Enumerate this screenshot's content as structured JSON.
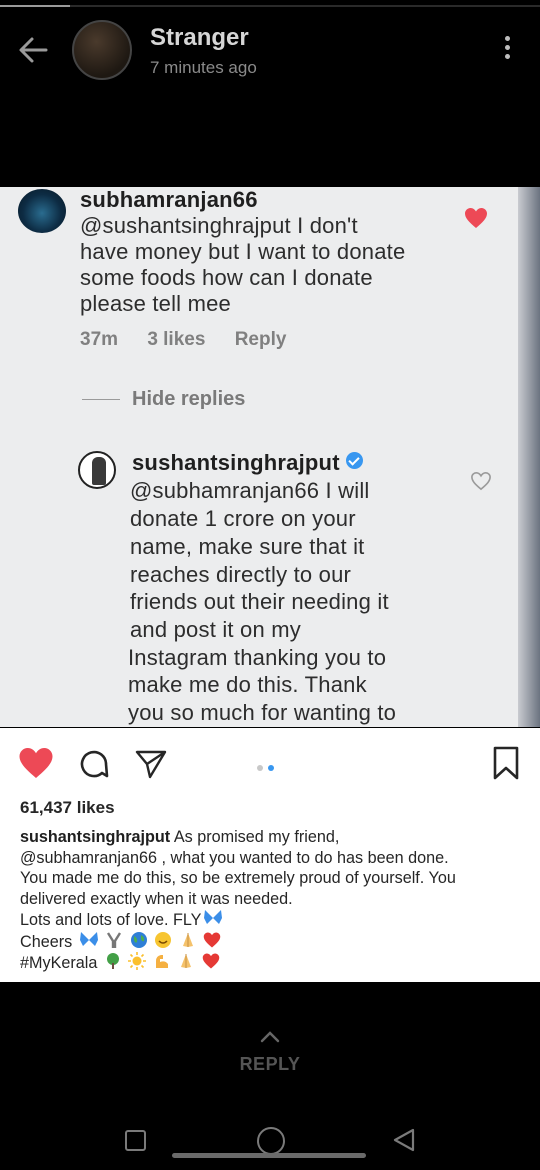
{
  "header": {
    "contact_name": "Stranger",
    "last_seen": "7 minutes ago"
  },
  "shared_screenshot": {
    "comment": {
      "username": "subhamranjan66",
      "lines": [
        "@sushantsinghrajput I don't",
        "have money but I want to donate",
        "some foods how can I donate",
        "please tell mee"
      ],
      "time": "37m",
      "likes": "3 likes",
      "reply": "Reply",
      "liked": true
    },
    "hide_replies": "Hide replies",
    "reply_comment": {
      "username": "sushantsinghrajput",
      "verified": true,
      "lines": [
        "@subhamranjan66 I will",
        "donate 1 crore on your",
        "name, make sure that it",
        "reaches directly to our",
        "friends out their needing it",
        "and post it on my",
        "Instagram thanking you to",
        "make me do this. Thank",
        "you so much for wanting to"
      ]
    }
  },
  "post": {
    "likes": "61,437 likes",
    "caption_user": "sushantsinghrajput",
    "caption_line1": "As promised my friend,",
    "caption_line2": "@subhamranjan66 , what you wanted to do has been done.",
    "caption_line3": "You made me do this, so be extremely proud of yourself. You",
    "caption_line4": "delivered exactly when it was needed.",
    "caption_line5": "Lots and lots of love. FLY",
    "caption_line6": "Cheers",
    "caption_line7": "#MyKerala"
  },
  "footer": {
    "reply_label": "REPLY"
  },
  "colors": {
    "accent_blue": "#3897f0",
    "heart_red": "#ed4956"
  }
}
